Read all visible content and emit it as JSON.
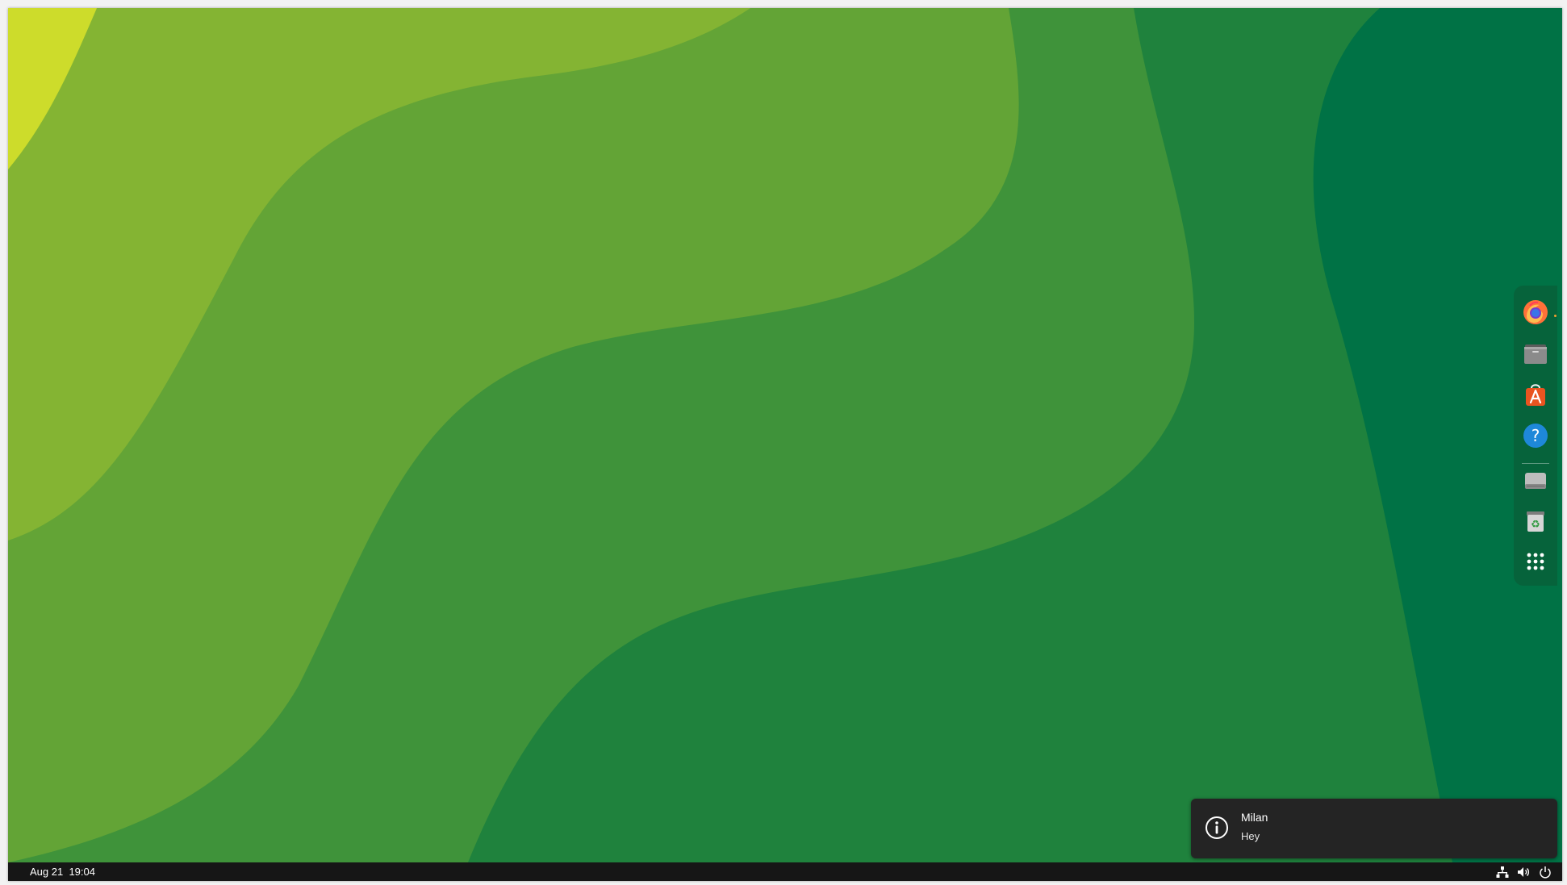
{
  "desktop": {
    "wallpaper_colors": [
      "#cddc2b",
      "#a5c52f",
      "#84b433",
      "#63a436",
      "#3f933a",
      "#1f823d",
      "#007245"
    ]
  },
  "dock": {
    "items": [
      {
        "name": "Firefox",
        "icon": "firefox-icon",
        "running": true
      },
      {
        "name": "Files",
        "icon": "folder-icon",
        "running": false
      },
      {
        "name": "Ubuntu Software",
        "icon": "app-store-icon",
        "running": false
      },
      {
        "name": "Help",
        "icon": "help-icon",
        "running": false
      },
      {
        "name": "Drive",
        "icon": "drive-icon",
        "running": false
      },
      {
        "name": "Trash",
        "icon": "trash-icon",
        "running": false
      },
      {
        "name": "Show Applications",
        "icon": "app-grid-icon",
        "running": false
      }
    ]
  },
  "notification": {
    "title": "Milan",
    "body": "Hey",
    "icon": "info-icon"
  },
  "taskbar": {
    "date": "Aug 21",
    "time": "19:04",
    "tray": [
      "network-icon",
      "volume-icon",
      "power-icon"
    ]
  }
}
